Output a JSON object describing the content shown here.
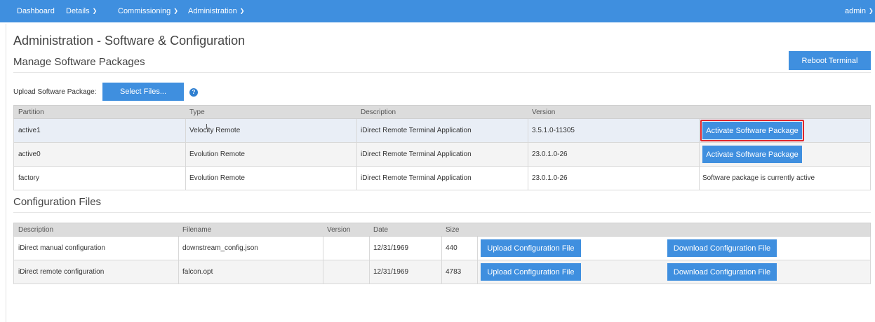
{
  "navbar": {
    "items": [
      {
        "label": "Dashboard"
      },
      {
        "label": "Details"
      },
      {
        "label": "Commissioning"
      },
      {
        "label": "Administration"
      }
    ],
    "user": "admin",
    "bg_color": "#3f8fdf"
  },
  "page": {
    "title": "Administration - Software & Configuration"
  },
  "software": {
    "section_title": "Manage Software Packages",
    "reboot_label": "Reboot Terminal",
    "upload_label": "Upload Software Package:",
    "select_files_label": "Select Files...",
    "help_icon": "question-circle-icon",
    "columns": [
      "Partition",
      "Type",
      "Description",
      "Version"
    ],
    "rows": [
      {
        "partition": "active1",
        "type": "Velocity Remote",
        "description": "iDirect Remote Terminal Application",
        "version": "3.5.1.0-11305",
        "action": "Activate Software Package",
        "highlighted": true
      },
      {
        "partition": "active0",
        "type": "Evolution Remote",
        "description": "iDirect Remote Terminal Application",
        "version": "23.0.1.0-26",
        "action": "Activate Software Package"
      },
      {
        "partition": "factory",
        "type": "Evolution Remote",
        "description": "iDirect Remote Terminal Application",
        "version": "23.0.1.0-26",
        "status": "Software package is currently active"
      }
    ]
  },
  "config": {
    "section_title": "Configuration Files",
    "columns": [
      "Description",
      "Filename",
      "Version",
      "Date",
      "Size"
    ],
    "rows": [
      {
        "description": "iDirect manual configuration",
        "filename": "downstream_config.json",
        "version": "",
        "date": "12/31/1969",
        "size": "440",
        "upload_label": "Upload Configuration File",
        "download_label": "Download Configuration File"
      },
      {
        "description": "iDirect remote configuration",
        "filename": "falcon.opt",
        "version": "",
        "date": "12/31/1969",
        "size": "4783",
        "upload_label": "Upload Configuration File",
        "download_label": "Download Configuration File"
      }
    ]
  },
  "colors": {
    "accent": "#3f8fdf",
    "highlight_border": "#e0262b"
  }
}
